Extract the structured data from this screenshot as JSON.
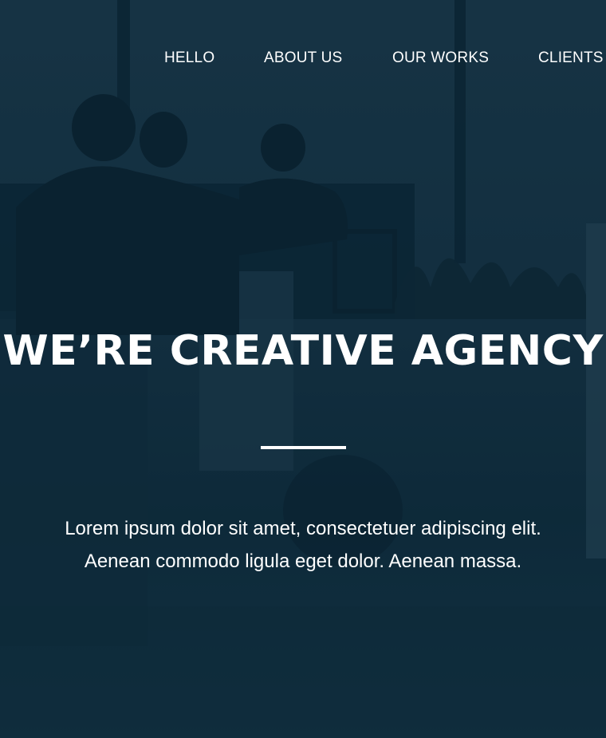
{
  "nav": {
    "items": [
      {
        "label": "HELLO"
      },
      {
        "label": "ABOUT US"
      },
      {
        "label": "OUR WORKS"
      },
      {
        "label": "CLIENTS"
      }
    ]
  },
  "hero": {
    "headline": "WE’RE CREATIVE AGENCY",
    "description_lines": [
      "Lorem ipsum dolor sit amet, consectetuer adipiscing elit.",
      "Aenean commodo ligula eget dolor. Aenean massa."
    ]
  },
  "colors": {
    "overlay": "#163242",
    "text": "#ffffff"
  },
  "background": {
    "image": "office-people-silhouette-photo"
  }
}
